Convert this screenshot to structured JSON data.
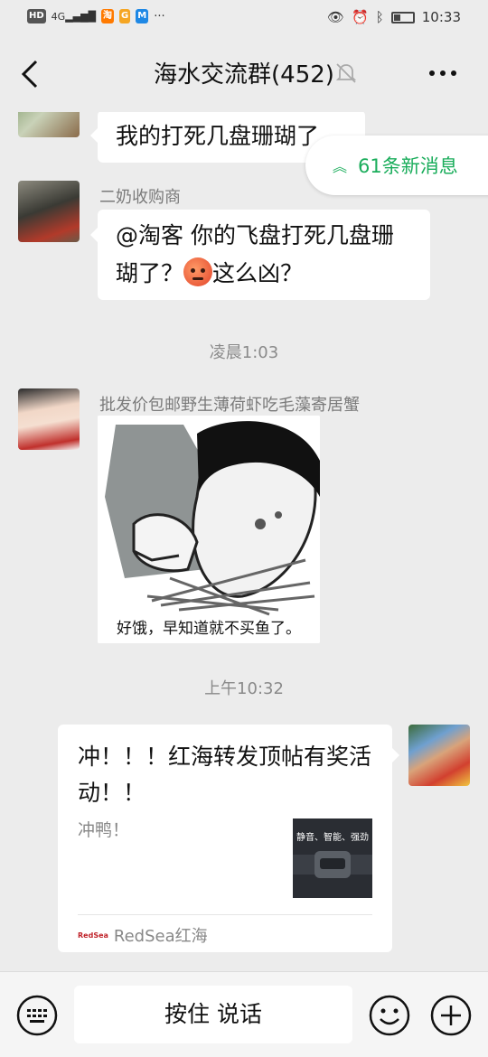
{
  "statusbar": {
    "left_chips": [
      "HD",
      "4G",
      "淘",
      "G",
      "M"
    ],
    "time": "10:33"
  },
  "header": {
    "title": "海水交流群(452)"
  },
  "new_messages": {
    "label": "61条新消息"
  },
  "messages": [
    {
      "text": "我的打死几盘珊瑚了"
    },
    {
      "sender": "二奶收购商",
      "text_a": "@淘客   你的飞盘打死几盘珊瑚了？",
      "text_b": "这么凶？"
    },
    {
      "timestamp": "凌晨1:03"
    },
    {
      "sender": "批发价包邮野生薄荷虾吃毛藻寄居蟹",
      "sticker_caption": "好饿，早知道就不买鱼了。"
    },
    {
      "timestamp": "上午10:32"
    }
  ],
  "link_card": {
    "title": "冲！！！红海转发顶帖有奖活动！！",
    "desc": "冲鸭！",
    "thumb_text": "静音、智能、强劲",
    "source": "RedSea红海",
    "source_logo": "RedSea"
  },
  "inputbar": {
    "talk_label": "按住 说话"
  },
  "colors": {
    "background": "#ececec",
    "bubble": "#ffffff",
    "accent_green": "#1aad5b"
  }
}
